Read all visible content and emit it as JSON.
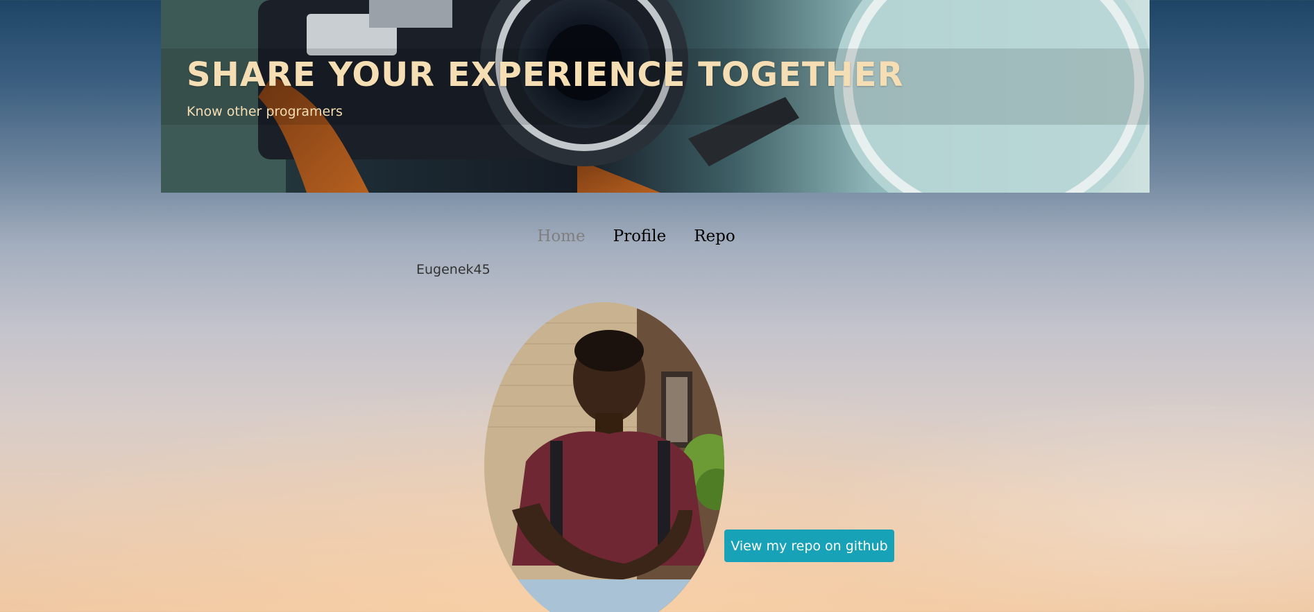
{
  "banner": {
    "title": "SHARE YOUR EXPERIENCE TOGETHER",
    "subtitle": "Know other programers"
  },
  "nav": {
    "items": [
      {
        "label": "Home",
        "active": true
      },
      {
        "label": "Profile",
        "active": false
      },
      {
        "label": "Repo",
        "active": false
      }
    ]
  },
  "profile": {
    "username": "Eugenek45",
    "button_label": "View my repo on github"
  },
  "colors": {
    "banner_text": "#f5deb3",
    "button_bg": "#17a2b8",
    "nav_active": "#7f7f7f"
  }
}
